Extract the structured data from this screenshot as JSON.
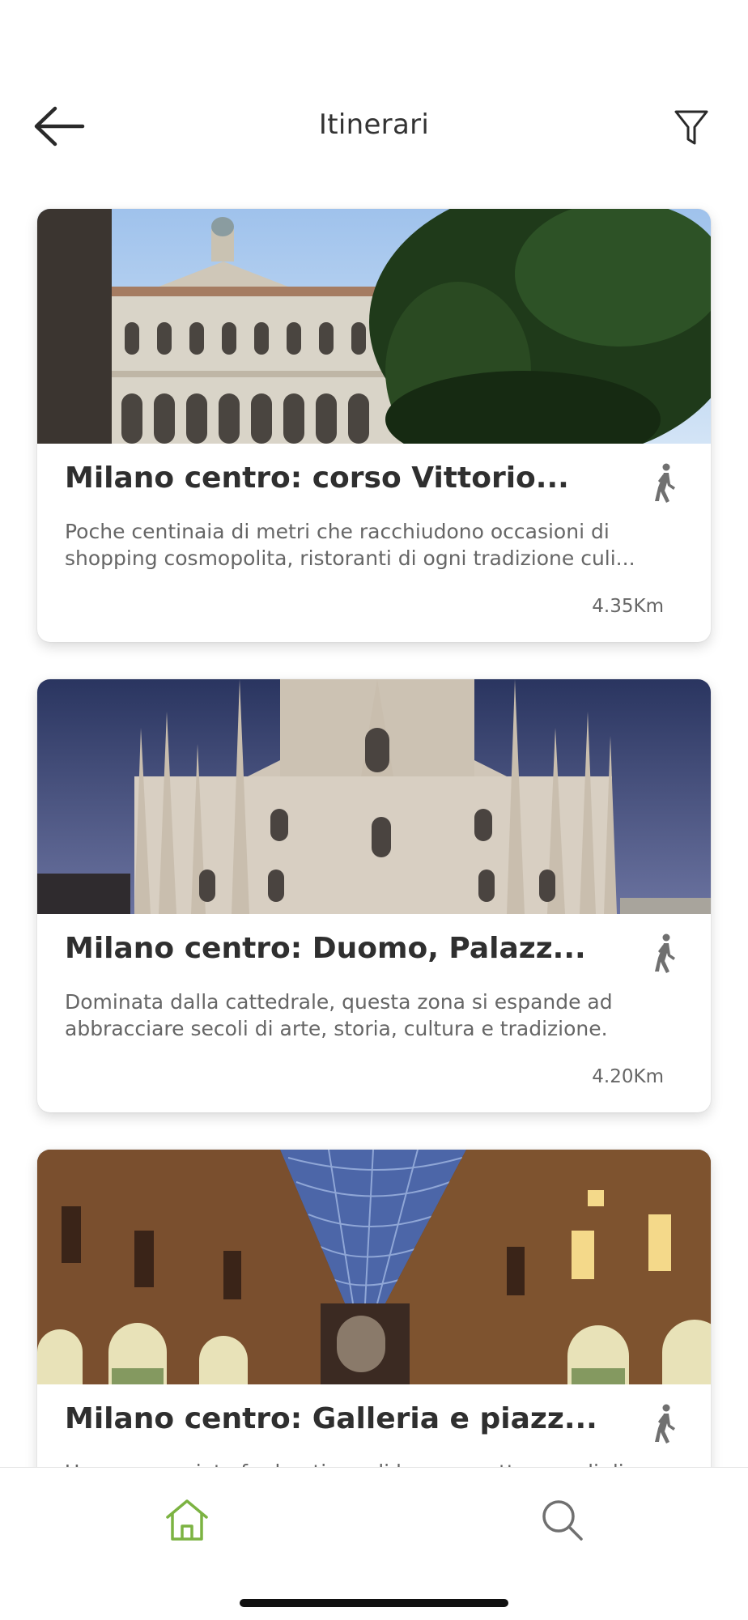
{
  "header": {
    "title": "Itinerari",
    "back_icon": "arrow-left-icon",
    "filter_icon": "filter-icon"
  },
  "itineraries": [
    {
      "title": "Milano centro: corso Vittorio...",
      "description": "Poche centinaia di metri che racchiudono occasioni di shopping cosmopolita, ristoranti di ogni tradizione culi...",
      "distance": "4.35Km",
      "mode_icon": "walking-person-icon"
    },
    {
      "title": "Milano centro: Duomo, Palazz...",
      "description": "Dominata dalla cattedrale, questa zona si espande ad abbracciare secoli di arte, storia, cultura e tradizione.",
      "distance": "4.20Km",
      "mode_icon": "walking-person-icon"
    },
    {
      "title": "Milano centro: Galleria e piazz...",
      "description": "Una passeggiata fra boutique di lusso, quattro secoli di",
      "distance": "",
      "mode_icon": "walking-person-icon"
    }
  ],
  "bottom_nav": {
    "items": [
      {
        "icon": "home-icon",
        "active": true
      },
      {
        "icon": "search-icon",
        "active": false
      }
    ]
  },
  "colors": {
    "accent": "#7cb342",
    "text": "#2f2f2f",
    "muted": "#666666",
    "icon": "#707070"
  }
}
